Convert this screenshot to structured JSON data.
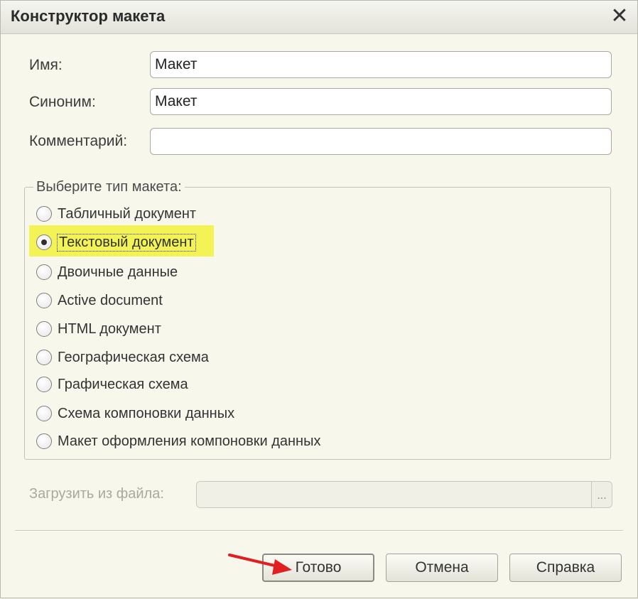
{
  "window": {
    "title": "Конструктор макета",
    "close_symbol": "✕"
  },
  "fields": {
    "name": {
      "label": "Имя:",
      "value": "Макет"
    },
    "synonym": {
      "label": "Синоним:",
      "value": "Макет"
    },
    "comment": {
      "label": "Комментарий:",
      "value": ""
    }
  },
  "layout_type": {
    "title": "Выберите тип макета:",
    "selected_index": 1,
    "options": [
      "Табличный документ",
      "Текстовый документ",
      "Двоичные данные",
      "Active document",
      "HTML документ",
      "Географическая схема",
      "Графическая схема",
      "Схема компоновки данных",
      "Макет оформления компоновки данных"
    ]
  },
  "file": {
    "label": "Загрузить из файла:",
    "value": "",
    "browse_label": "..."
  },
  "buttons": {
    "ok": "Готово",
    "cancel": "Отмена",
    "help": "Справка"
  },
  "colors": {
    "highlight": "#f3f356",
    "arrow": "#e02020"
  }
}
